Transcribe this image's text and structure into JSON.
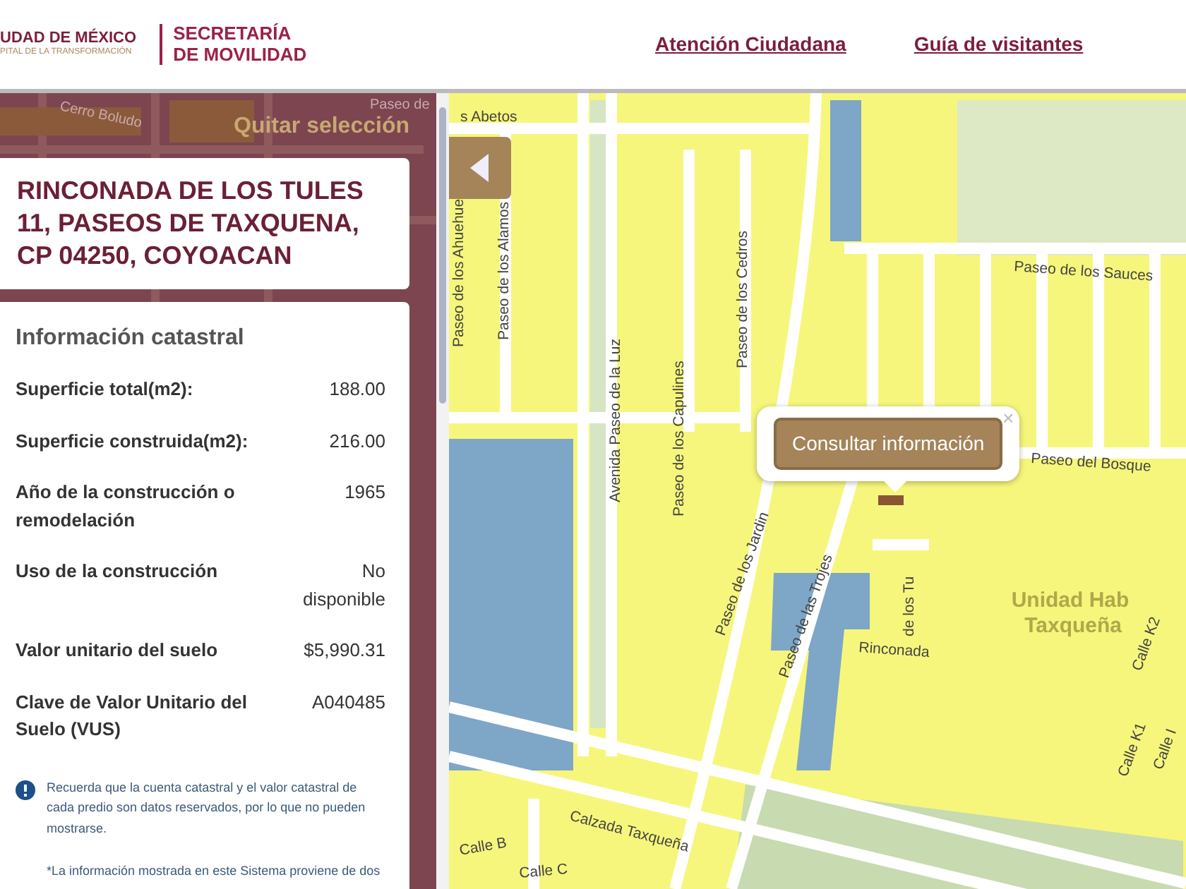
{
  "header": {
    "logo_primary": "UDAD DE MÉXICO",
    "logo_secondary": "PITAL DE LA TRANSFORMACIÓN",
    "agency_line_1": "SECRETARÍA",
    "agency_line_2": "DE MOVILIDAD",
    "links": [
      "Atención Ciudadana",
      "Guía de visitantes"
    ]
  },
  "sidebar": {
    "background_labels": [
      "Paseo de",
      "Cerro Boludo"
    ],
    "clear_selection": "Quitar selección",
    "address": "RINCONADA DE LOS TULES 11, PASEOS DE TAXQUENA, CP 04250, COYOACAN",
    "info": {
      "title": "Información catastral",
      "rows": [
        {
          "label": "Superficie total(m2):",
          "value": "188.00"
        },
        {
          "label": "Superficie construida(m2):",
          "value": "216.00"
        },
        {
          "label": "Año de la construcción o remodelación",
          "value": "1965"
        },
        {
          "label": "Uso de la construcción",
          "value": "No disponible"
        },
        {
          "label": "Valor unitario del suelo",
          "value": "$5,990.31"
        },
        {
          "label": "Clave de Valor Unitario del Suelo (VUS)",
          "value": "A040485"
        }
      ],
      "notice": "Recuerda que la cuenta catastral y el valor catastral de cada predio son datos reservados, por lo que no pueden mostrarse.",
      "footnote": "*La información mostrada en este Sistema proviene de dos"
    }
  },
  "map": {
    "labels": [
      "s Abetos",
      "Paseo de los Alamos",
      "Paseo de los Ahuehue",
      "Avenida Paseo de la Luz",
      "Paseo de los Capulines",
      "Paseo de los Cedros",
      "Paseo de los Sauces",
      "Paseo del Bosque",
      "Paseo de los Jardin",
      "Paseo de las Trojes",
      "Rinconada",
      "de los Tu",
      "Unidad Hab Taxqueña",
      "Calzada Taxqueña",
      "Calle K2",
      "Calle K1",
      "Calle I",
      "Calle B",
      "Calle C"
    ],
    "popup": {
      "button": "Consultar información",
      "close": "×"
    }
  }
}
